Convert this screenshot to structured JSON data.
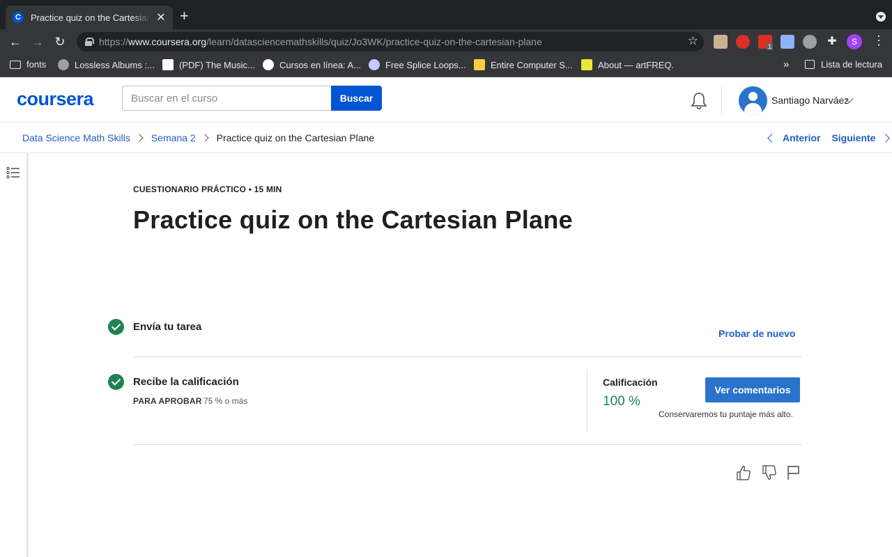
{
  "browser": {
    "tab_title": "Practice quiz on the Cartesian Plane",
    "tab_favicon": "C",
    "url_prefix": "https://",
    "url_domain": "www.coursera.org",
    "url_path": "/learn/datasciencemathskills/quiz/Jo3WK/practice-quiz-on-the-cartesian-plane",
    "profile_initial": "S",
    "extension_badge": "1",
    "bookmarks": [
      {
        "label": "fonts",
        "icon": "folder-icon"
      },
      {
        "label": "Lossless Albums :...",
        "icon": "globe-icon"
      },
      {
        "label": "(PDF) The Music...",
        "icon": "academia-icon"
      },
      {
        "label": "Cursos en línea: A...",
        "icon": "udemy-icon"
      },
      {
        "label": "Free Splice Loops...",
        "icon": "splice-icon"
      },
      {
        "label": "Entire Computer S...",
        "icon": "ml-icon"
      },
      {
        "label": "About — artFREQ.",
        "icon": "artfreq-icon"
      }
    ],
    "reading_list": "Lista de lectura"
  },
  "header": {
    "logo": "coursera",
    "search_placeholder": "Buscar en el curso",
    "search_button": "Buscar",
    "user_name": "Santiago Narváez"
  },
  "breadcrumb": {
    "course": "Data Science Math Skills",
    "week": "Semana 2",
    "current": "Practice quiz on the Cartesian Plane",
    "prev": "Anterior",
    "next": "Siguiente"
  },
  "quiz": {
    "meta": "CUESTIONARIO PRÁCTICO • 15 MIN",
    "title": "Practice quiz on the Cartesian Plane",
    "submit_label": "Envía tu tarea",
    "retry": "Probar de nuevo",
    "receive_label": "Recibe la calificación",
    "pass_label": "PARA APROBAR",
    "pass_value": "75 % o más",
    "grade_label": "Calificación",
    "grade_value": "100 %",
    "feedback_button": "Ver comentarios",
    "keep_note": "Conservaremos tu puntaje más alto."
  },
  "colors": {
    "brand": "#0056d2",
    "success": "#1f8354",
    "link": "#1f5fbf"
  }
}
